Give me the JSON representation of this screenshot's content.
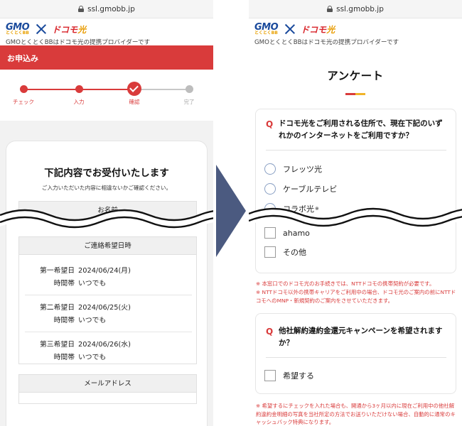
{
  "browser": {
    "url": "ssl.gmobb.jp"
  },
  "brand": {
    "gmo_logo": "GMO",
    "gmo_sub": "とくとくBB",
    "docomo_logo": "ドコモ",
    "docomo_hikari": "光",
    "tagline": "GMOとくとくBBはドコモ光の提携プロバイダーです"
  },
  "colors": {
    "accent_red": "#d93b3b",
    "accent_yellow": "#f0b429",
    "arrow": "#4b5a80"
  },
  "left": {
    "band_title": "お申込み",
    "steps": [
      {
        "label": "チェック",
        "state": "done"
      },
      {
        "label": "入力",
        "state": "done"
      },
      {
        "label": "確認",
        "state": "current"
      },
      {
        "label": "完了",
        "state": "todo"
      }
    ],
    "card": {
      "title": "下記内容でお受付いたします",
      "subtitle": "ご入力いただいた内容に相違ないかご確認ください。",
      "name_header": "お名前",
      "contact_header": "ご連絡希望日時",
      "preferences": [
        {
          "label": "第一希望日",
          "date": "2024/06/24(月)",
          "time_label": "時間帯",
          "time": "いつでも"
        },
        {
          "label": "第二希望日",
          "date": "2024/06/25(火)",
          "time_label": "時間帯",
          "time": "いつでも"
        },
        {
          "label": "第三希望日",
          "date": "2024/06/26(水)",
          "time_label": "時間帯",
          "time": "いつでも"
        }
      ],
      "email_header": "メールアドレス"
    }
  },
  "right": {
    "title": "アンケート",
    "q1": {
      "mark": "Q",
      "text": "ドコモ光をご利用される住所で、現在下記のいずれかのインターネットをご利用ですか？",
      "options": [
        "フレッツ光",
        "ケーブルテレビ",
        "コラボ光",
        "ahamo",
        "その他"
      ],
      "option_3_mark": "※"
    },
    "notes1": [
      "※ 本窓口でのドコモ光のお手続きでは、NTTドコモの携帯契約が必要です。",
      "※ NTTドコモ以外の携帯キャリアをご利用中の場合、ドコモ光のご案内の前にNTTドコモへのMNP・新規契約のご案内をさせていただきます。"
    ],
    "q2": {
      "mark": "Q",
      "text": "他社解約違約金還元キャンペーンを希望されますか？",
      "option": "希望する"
    },
    "notes2": [
      "※ 希望するにチェックを入れた場合も、開通から3ヶ月以内に現在ご利用中の他社解約違約金明細の写真を当社所定の方法でお送りいただけない場合、自動的に通常のキャッシュバック特典になります。"
    ]
  }
}
